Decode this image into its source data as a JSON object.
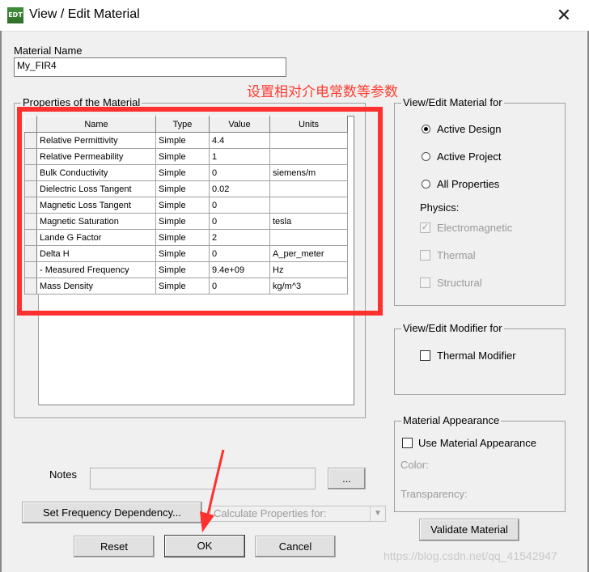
{
  "window": {
    "title": "View / Edit Material",
    "app_icon": "EDT",
    "close_glyph": "✕"
  },
  "material_name": {
    "label": "Material Name",
    "value": "My_FIR4"
  },
  "annotation": {
    "text": "设置相对介电常数等参数",
    "color": "#ff3b30"
  },
  "properties": {
    "group_title": "Properties of the Material",
    "columns": [
      "Name",
      "Type",
      "Value",
      "Units"
    ],
    "rows": [
      {
        "name": "Relative Permittivity",
        "type": "Simple",
        "value": "4.4",
        "units": ""
      },
      {
        "name": "Relative Permeability",
        "type": "Simple",
        "value": "1",
        "units": ""
      },
      {
        "name": "Bulk Conductivity",
        "type": "Simple",
        "value": "0",
        "units": "siemens/m"
      },
      {
        "name": "Dielectric Loss Tangent",
        "type": "Simple",
        "value": "0.02",
        "units": ""
      },
      {
        "name": "Magnetic Loss Tangent",
        "type": "Simple",
        "value": "0",
        "units": ""
      },
      {
        "name": "Magnetic Saturation",
        "type": "Simple",
        "value": "0",
        "units": "tesla"
      },
      {
        "name": "Lande G Factor",
        "type": "Simple",
        "value": "2",
        "units": ""
      },
      {
        "name": "Delta H",
        "type": "Simple",
        "value": "0",
        "units": "A_per_meter"
      },
      {
        "name": "- Measured Frequency",
        "type": "Simple",
        "value": "9.4e+09",
        "units": "Hz"
      },
      {
        "name": "Mass Density",
        "type": "Simple",
        "value": "0",
        "units": "kg/m^3"
      }
    ]
  },
  "view_edit_material": {
    "title": "View/Edit Material for",
    "options": [
      "Active Design",
      "Active Project",
      "All Properties"
    ],
    "selected": "Active Design",
    "physics_label": "Physics:",
    "physics": [
      {
        "label": "Electromagnetic",
        "checked": true
      },
      {
        "label": "Thermal",
        "checked": false
      },
      {
        "label": "Structural",
        "checked": false
      }
    ]
  },
  "modifier": {
    "title": "View/Edit Modifier for",
    "thermal_label": "Thermal Modifier"
  },
  "appearance": {
    "title": "Material Appearance",
    "use_label": "Use Material Appearance",
    "color_label": "Color:",
    "transparency_label": "Transparency:"
  },
  "notes": {
    "label": "Notes",
    "value": "",
    "browse_label": "..."
  },
  "buttons": {
    "set_freq": "Set Frequency Dependency...",
    "calc_props": "Calculate Properties for:",
    "validate": "Validate Material",
    "reset": "Reset",
    "ok": "OK",
    "cancel": "Cancel"
  },
  "watermark": "https://blog.csdn.net/qq_41542947"
}
